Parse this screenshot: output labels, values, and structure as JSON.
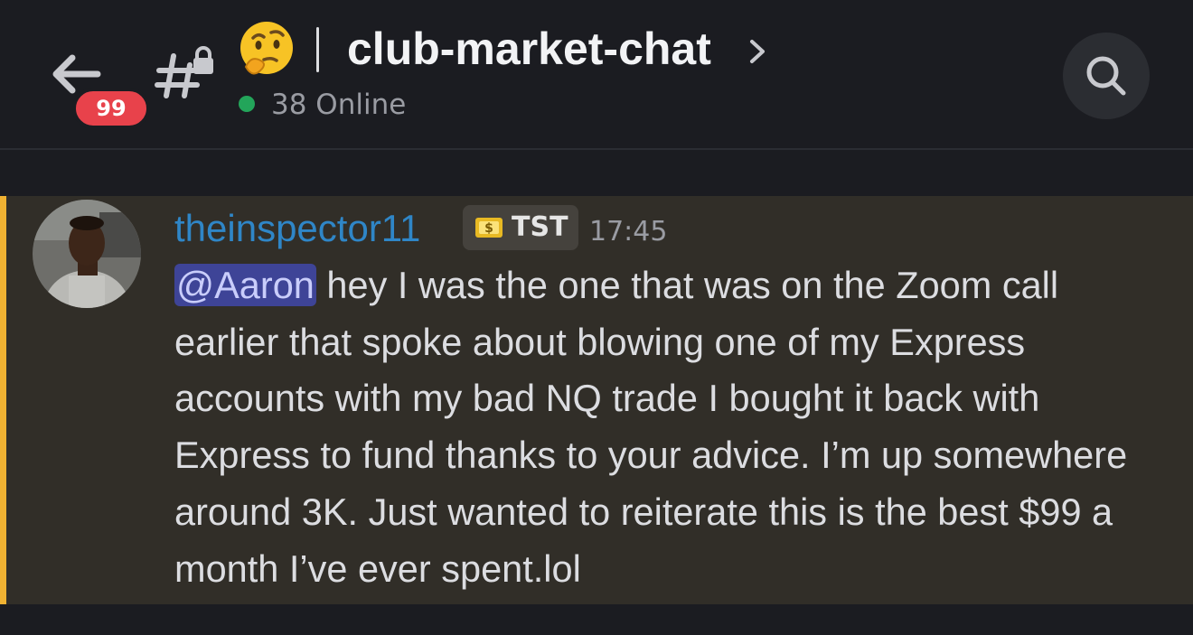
{
  "header": {
    "unread_badge": "99",
    "channel_emoji": "thinking-face",
    "channel_name": "club-market-chat",
    "online_status": "38 Online",
    "colors": {
      "online": "#23a55a",
      "badge": "#e8424b"
    }
  },
  "message": {
    "author": "theinspector11",
    "role_tag": "TST",
    "timestamp": "17:45",
    "mention": "@Aaron",
    "text": " hey I was the one that was on the Zoom call earlier that spoke about blowing one of my Express accounts with my bad NQ trade I bought it back with Express to fund thanks to your advice. I’m up somewhere around 3K. Just wanted to reiterate this is the best $99 a month I’ve ever spent.lol",
    "colors": {
      "author": "#2f86c7",
      "mention_highlight": "#f0b232"
    }
  }
}
